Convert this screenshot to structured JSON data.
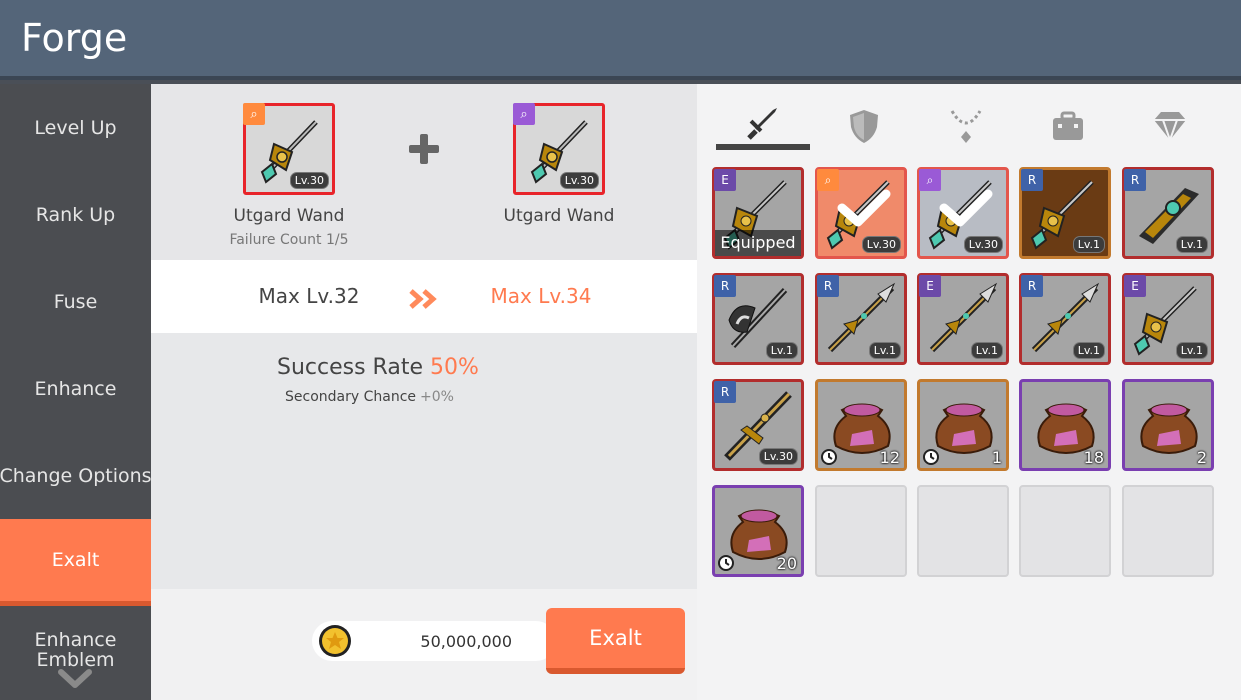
{
  "header": {
    "title": "Forge"
  },
  "sidebar": {
    "items": [
      {
        "label": "Level Up"
      },
      {
        "label": "Rank Up"
      },
      {
        "label": "Fuse"
      },
      {
        "label": "Enhance"
      },
      {
        "label": "Change Options"
      },
      {
        "label": "Exalt"
      },
      {
        "label": "Enhance Emblem"
      }
    ],
    "active": "Exalt"
  },
  "materials": {
    "left": {
      "name": "Utgard Wand",
      "level": "Lv.30",
      "rank_color": "#ff8a3d",
      "failure_count": "Failure Count 1/5"
    },
    "right": {
      "name": "Utgard Wand",
      "level": "Lv.30",
      "rank_color": "#9a5ad6"
    }
  },
  "max_level": {
    "current": "Max Lv.32",
    "next": "Max Lv.34"
  },
  "rate": {
    "label": "Success Rate",
    "value": "50%",
    "secondary_label": "Secondary Chance",
    "secondary_value": "+0%"
  },
  "cost": {
    "value": "50,000,000"
  },
  "exalt_button": {
    "label": "Exalt"
  },
  "tabs": [
    "sword-icon",
    "shield-icon",
    "necklace-icon",
    "briefcase-icon",
    "diamond-icon"
  ],
  "inventory": [
    {
      "rank": "E",
      "level": "",
      "label": "Equipped",
      "count": "",
      "icon": "wand-icon"
    },
    {
      "rank": "",
      "level": "Lv.30",
      "label": "",
      "count": "",
      "icon": "wand-icon",
      "selected": true
    },
    {
      "rank": "",
      "level": "Lv.30",
      "label": "",
      "count": "",
      "icon": "wand-icon",
      "selected": true
    },
    {
      "rank": "R",
      "level": "Lv.1",
      "label": "",
      "count": "",
      "icon": "wand-icon"
    },
    {
      "rank": "R",
      "level": "Lv.1",
      "label": "",
      "count": "",
      "icon": "cannon-icon"
    },
    {
      "rank": "R",
      "level": "Lv.1",
      "label": "",
      "count": "",
      "icon": "axe-icon"
    },
    {
      "rank": "R",
      "level": "Lv.1",
      "label": "",
      "count": "",
      "icon": "spear-icon"
    },
    {
      "rank": "E",
      "level": "Lv.1",
      "label": "",
      "count": "",
      "icon": "spear-icon"
    },
    {
      "rank": "R",
      "level": "Lv.1",
      "label": "",
      "count": "",
      "icon": "spear-icon"
    },
    {
      "rank": "E",
      "level": "Lv.1",
      "label": "",
      "count": "",
      "icon": "wand-icon"
    },
    {
      "rank": "R",
      "level": "Lv.30",
      "label": "",
      "count": "",
      "icon": "sword-icon"
    },
    {
      "rank": "",
      "level": "",
      "label": "",
      "count": "12",
      "icon": "pouch-icon"
    },
    {
      "rank": "",
      "level": "",
      "label": "",
      "count": "1",
      "icon": "pouch-icon"
    },
    {
      "rank": "",
      "level": "",
      "label": "",
      "count": "18",
      "icon": "pouch-icon"
    },
    {
      "rank": "",
      "level": "",
      "label": "",
      "count": "2",
      "icon": "pouch-icon"
    },
    {
      "rank": "",
      "level": "",
      "label": "",
      "count": "20",
      "icon": "pouch-icon"
    }
  ]
}
